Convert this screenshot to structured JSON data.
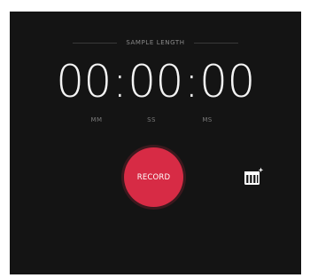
{
  "sample_length_label": "SAMPLE LENGTH",
  "timer": {
    "minutes": "00",
    "seconds": "00",
    "milliseconds": "00",
    "separator": ":"
  },
  "units": {
    "minutes": "MM",
    "seconds": "SS",
    "milliseconds": "MS"
  },
  "record_button": {
    "label": "RECORD",
    "color": "#d72b45"
  },
  "keys_button": {
    "icon": "piano-keys-add-icon"
  },
  "colors": {
    "background": "#141414",
    "accent": "#d72b45"
  }
}
